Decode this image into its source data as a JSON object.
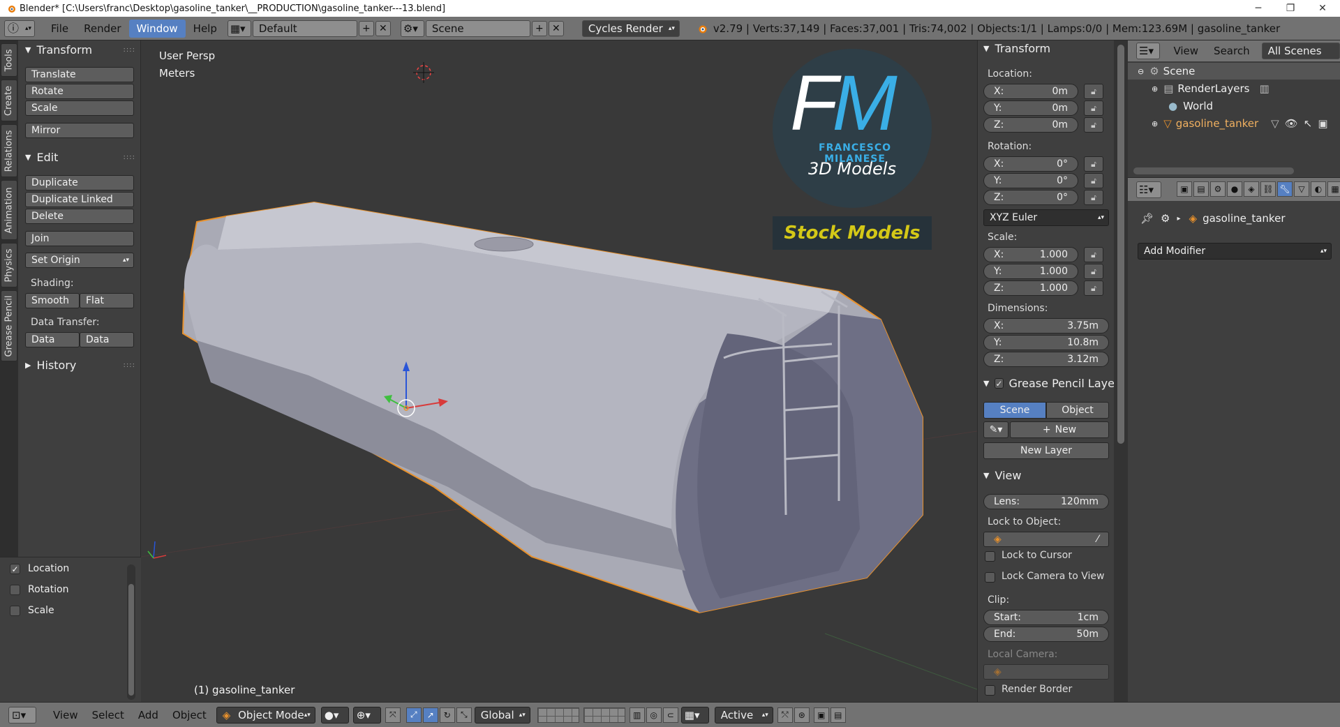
{
  "window": {
    "title": "Blender* [C:\\Users\\franc\\Desktop\\gasoline_tanker\\__PRODUCTION\\gasoline_tanker---13.blend]",
    "minimize": "─",
    "maximize": "❐",
    "close": "✕"
  },
  "menubar": {
    "info_icon": "ⓘ",
    "items": [
      "File",
      "Render",
      "Window",
      "Help"
    ],
    "active_item": "Window",
    "screen_layout": "Default",
    "scene": "Scene",
    "render_engine": "Cycles Render",
    "stats": "v2.79 | Verts:37,149 | Faces:37,001 | Tris:74,002 | Objects:1/1 | Lamps:0/0 | Mem:123.69M | gasoline_tanker"
  },
  "left_tabs": [
    "Tools",
    "Create",
    "Relations",
    "Animation",
    "Physics",
    "Grease Pencil"
  ],
  "toolshelf": {
    "transform": {
      "header": "Transform",
      "buttons": [
        "Translate",
        "Rotate",
        "Scale",
        "Mirror"
      ]
    },
    "edit": {
      "header": "Edit",
      "buttons": [
        "Duplicate",
        "Duplicate Linked",
        "Delete",
        "Join"
      ],
      "set_origin": "Set Origin",
      "shading_label": "Shading:",
      "smooth": "Smooth",
      "flat": "Flat",
      "data_transfer_label": "Data Transfer:",
      "data": "Data",
      "data_layout": "Data Layo"
    },
    "history": "History"
  },
  "last_operator": {
    "options": [
      {
        "label": "Location",
        "checked": true
      },
      {
        "label": "Rotation",
        "checked": false
      },
      {
        "label": "Scale",
        "checked": false
      }
    ]
  },
  "viewport": {
    "view_name": "User Persp",
    "units": "Meters",
    "object_label": "(1) gasoline_tanker",
    "logo": {
      "initial_f": "F",
      "initial_m": "M",
      "name": "FRANCESCO MILANESE",
      "subtitle": "3D Models",
      "banner": "Stock Models"
    }
  },
  "npanel": {
    "transform_header": "Transform",
    "location_label": "Location:",
    "location": [
      {
        "k": "X:",
        "v": "0m"
      },
      {
        "k": "Y:",
        "v": "0m"
      },
      {
        "k": "Z:",
        "v": "0m"
      }
    ],
    "rotation_label": "Rotation:",
    "rotation": [
      {
        "k": "X:",
        "v": "0°"
      },
      {
        "k": "Y:",
        "v": "0°"
      },
      {
        "k": "Z:",
        "v": "0°"
      }
    ],
    "rotation_mode": "XYZ Euler",
    "scale_label": "Scale:",
    "scale": [
      {
        "k": "X:",
        "v": "1.000"
      },
      {
        "k": "Y:",
        "v": "1.000"
      },
      {
        "k": "Z:",
        "v": "1.000"
      }
    ],
    "dimensions_label": "Dimensions:",
    "dimensions": [
      {
        "k": "X:",
        "v": "3.75m"
      },
      {
        "k": "Y:",
        "v": "10.8m"
      },
      {
        "k": "Z:",
        "v": "3.12m"
      }
    ],
    "grease_header": "Grease Pencil Layer",
    "gp_scene": "Scene",
    "gp_object": "Object",
    "gp_new": "New",
    "gp_new_layer": "New Layer",
    "view_header": "View",
    "lens_label": "Lens:",
    "lens_value": "120mm",
    "lock_object_label": "Lock to Object:",
    "lock_cursor": "Lock to Cursor",
    "lock_camera": "Lock Camera to View",
    "clip_label": "Clip:",
    "clip_start_k": "Start:",
    "clip_start_v": "1cm",
    "clip_end_k": "End:",
    "clip_end_v": "50m",
    "local_camera": "Local Camera:",
    "render_border": "Render Border"
  },
  "outliner": {
    "menu": [
      "View",
      "Search"
    ],
    "filter": "All Scenes",
    "rows": [
      "Scene",
      "RenderLayers",
      "World",
      "gasoline_tanker"
    ]
  },
  "properties": {
    "object_name": "gasoline_tanker",
    "add_modifier": "Add Modifier"
  },
  "bottombar": {
    "menu": [
      "View",
      "Select",
      "Add",
      "Object"
    ],
    "mode": "Object Mode",
    "orientation": "Global",
    "pivot": "Active"
  },
  "colors": {
    "accent": "#5680c2",
    "selection_outline": "#e8912c",
    "logo_blue": "#3aaee6",
    "stock_yellow": "#d4c817"
  }
}
